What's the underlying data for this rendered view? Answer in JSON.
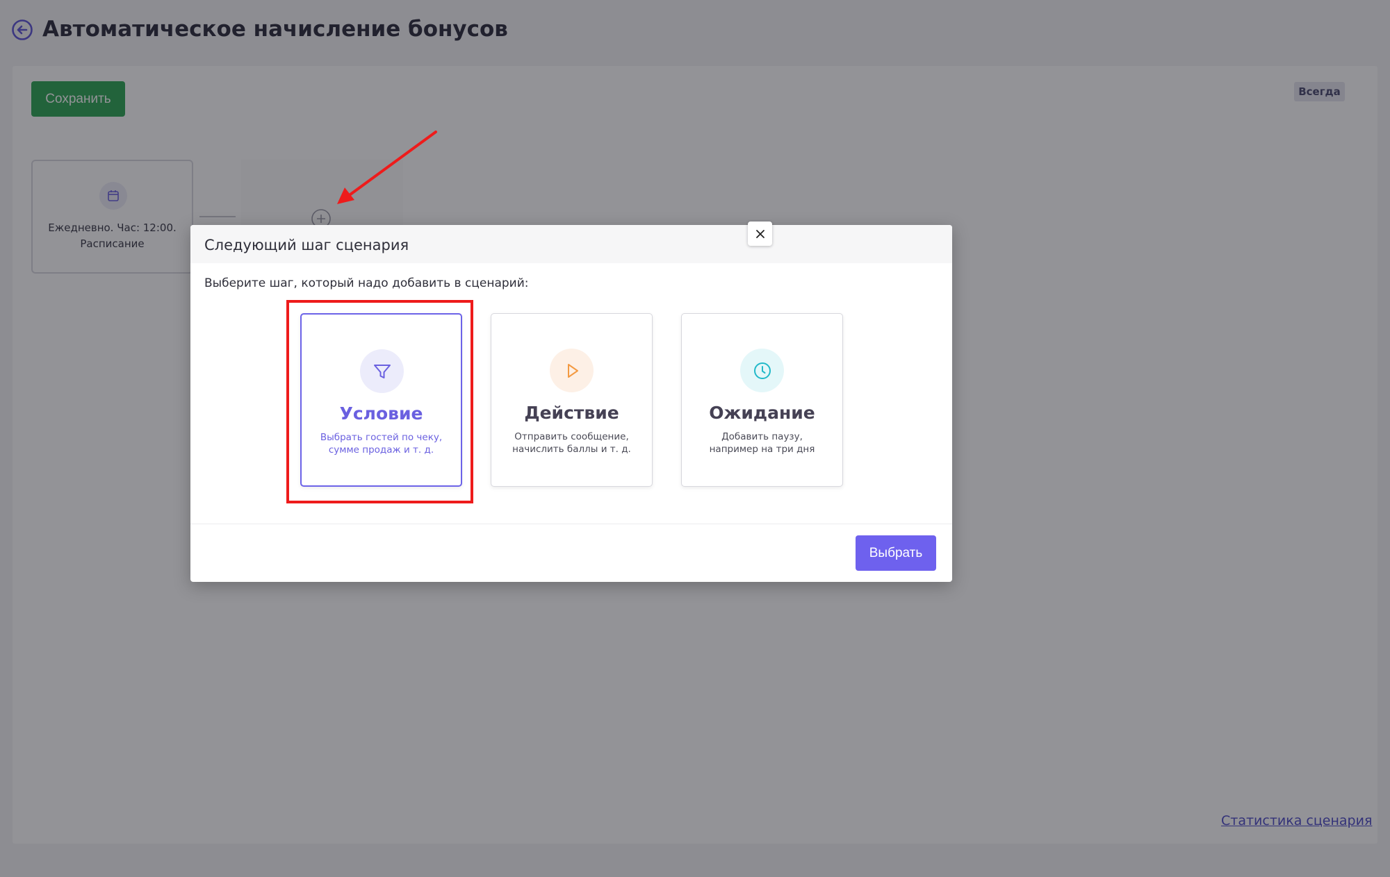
{
  "page": {
    "title": "Автоматическое начисление бонусов",
    "save_label": "Сохранить",
    "badge": "Всегда",
    "stats_link": "Статистика сценария"
  },
  "trigger_node": {
    "line1": "Ежедневно. Час: 12:00.",
    "line2": "Расписание",
    "icon": "calendar-icon"
  },
  "modal": {
    "title": "Следующий шаг сценария",
    "prompt": "Выберите шаг, который надо добавить в сценарий:",
    "select_label": "Выбрать",
    "options": [
      {
        "name": "Условие",
        "desc1": "Выбрать гостей по чеку,",
        "desc2": "сумме продаж и т. д.",
        "icon": "filter-icon",
        "color": "#6a60e0",
        "bg": "#ececfb",
        "selected": true
      },
      {
        "name": "Действие",
        "desc1": "Отправить сообщение,",
        "desc2": "начислить баллы и т. д.",
        "icon": "play-icon",
        "color": "#f39a42",
        "bg": "#fdf0e6",
        "selected": false
      },
      {
        "name": "Ожидание",
        "desc1": "Добавить паузу,",
        "desc2": "например на три дня",
        "icon": "clock-icon",
        "color": "#21b9c9",
        "bg": "#e4f7f9",
        "selected": false
      }
    ]
  },
  "colors": {
    "accent": "#6e61ee",
    "save": "#2fa656",
    "annotation": "#ee1b1b"
  }
}
